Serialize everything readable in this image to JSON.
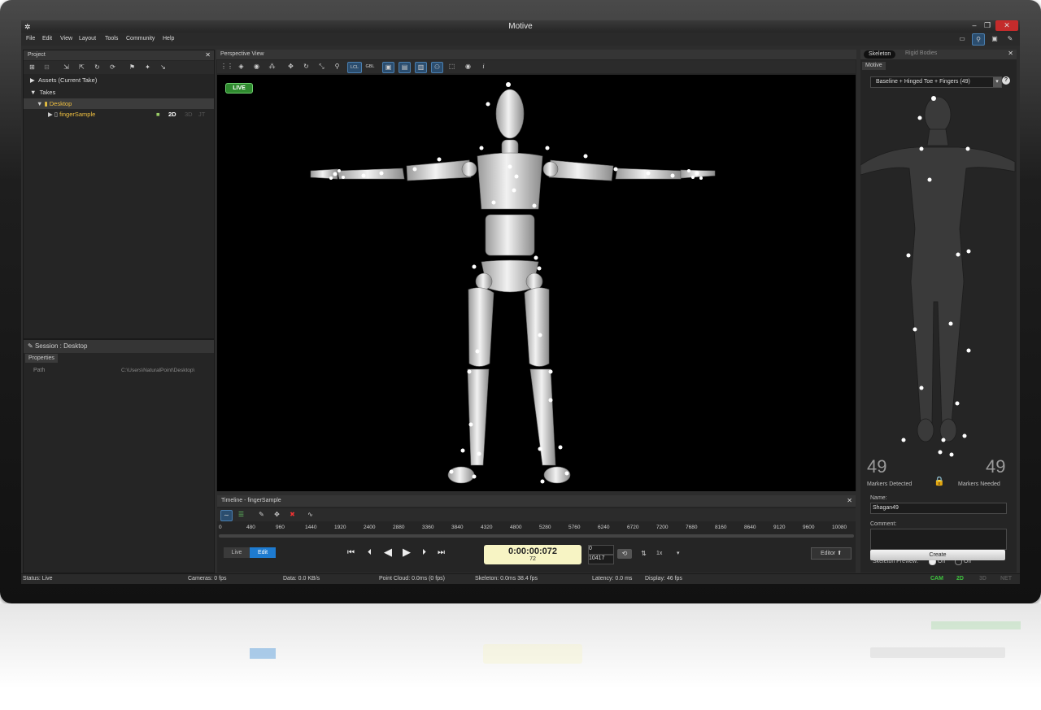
{
  "window": {
    "title": "Motive"
  },
  "menu": [
    "File",
    "Edit",
    "View",
    "Layout",
    "Tools",
    "Community",
    "Help"
  ],
  "project": {
    "header": "Project",
    "assets_label": "Assets (Current Take)",
    "takes_label": "Takes",
    "folder": "Desktop",
    "take": {
      "name": "fingerSample",
      "badge_2d": "2D",
      "badge_3d": "3D",
      "badge_jt": "JT"
    }
  },
  "session": {
    "header": "Session : Desktop",
    "tab": "Properties",
    "path_label": "Path",
    "path_value": "C:\\Users\\NaturalPoint\\Desktop\\"
  },
  "viewport": {
    "header": "Perspective View",
    "live_badge": "LIVE",
    "lcl": "LCL",
    "gbl": "GBL"
  },
  "timeline": {
    "header": "Timeline - fingerSample",
    "ticks": [
      "0",
      "480",
      "960",
      "1440",
      "1920",
      "2400",
      "2880",
      "3360",
      "3840",
      "4320",
      "4800",
      "5280",
      "5760",
      "6240",
      "6720",
      "7200",
      "7680",
      "8160",
      "8640",
      "9120",
      "9600",
      "10080"
    ],
    "mode_live": "Live",
    "mode_edit": "Edit",
    "timecode": "0:00:00:072",
    "frame": "72",
    "range_start": "0",
    "range_end": "10417",
    "speed": "1x",
    "editor": "Editor"
  },
  "skeleton_panel": {
    "tab_skeleton": "Skeleton",
    "tab_rigid": "Rigid Bodies",
    "subtab": "Motive",
    "markerset": "Baseline + Hinged Toe + Fingers (49)",
    "markers_detected": "49",
    "markers_detected_label": "Markers Detected",
    "markers_needed": "49",
    "markers_needed_label": "Markers Needed",
    "name_label": "Name:",
    "name_value": "Shagan49",
    "comment_label": "Comment:",
    "preview_label": "Skeleton Preview:",
    "preview_on": "On",
    "preview_off": "Off",
    "create_button": "Create"
  },
  "status": {
    "status": "Status: Live",
    "cameras": "Cameras: 0 fps",
    "data": "Data: 0.0 KB/s",
    "pointcloud": "Point Cloud: 0.0ms (0 fps)",
    "skeleton": "Skeleton: 0.0ms 38.4 fps",
    "latency": "Latency: 0.0 ms",
    "display": "Display: 46 fps",
    "cam": "CAM",
    "d2": "2D",
    "d3": "3D",
    "net": "NET"
  },
  "colors": {
    "accent": "#1e7bd0",
    "live_green": "#2f8a2f",
    "status_green": "#3ec43e"
  }
}
